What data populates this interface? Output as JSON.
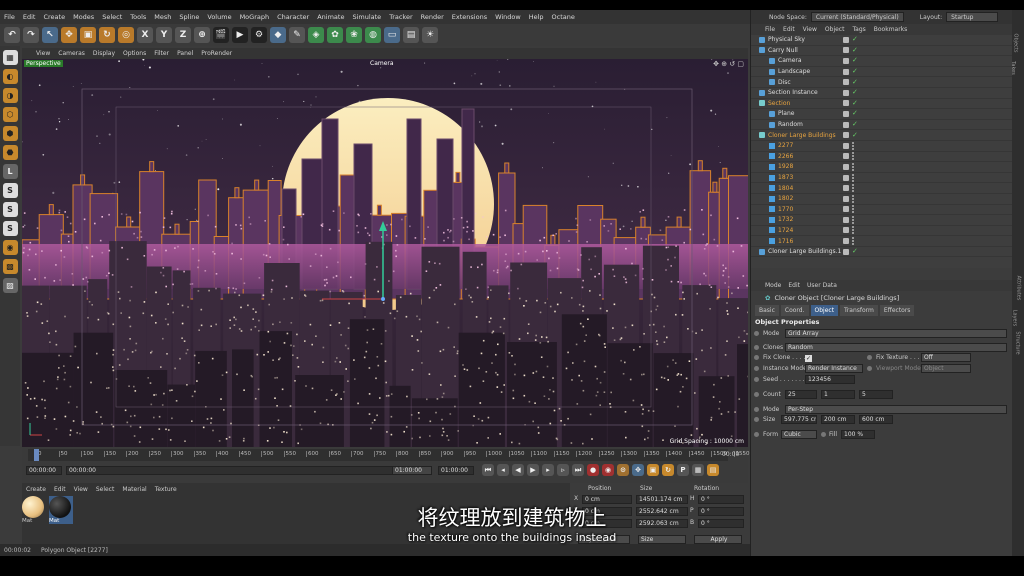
{
  "menubar": {
    "items": [
      "File",
      "Edit",
      "Create",
      "Modes",
      "Select",
      "Tools",
      "Mesh",
      "Spline",
      "Volume",
      "MoGraph",
      "Character",
      "Animate",
      "Simulate",
      "Tracker",
      "Render",
      "Extensions",
      "Window",
      "Help",
      "Octane"
    ]
  },
  "viewport": {
    "menu": [
      "View",
      "Cameras",
      "Display",
      "Options",
      "Filter",
      "Panel",
      "ProRender"
    ],
    "label_perspective": "Perspective",
    "label_camera": "Camera",
    "grid_spacing": "Grid Spacing : 10000 cm"
  },
  "timeline": {
    "ticks": [
      "0",
      "50",
      "100",
      "150",
      "200",
      "250",
      "300",
      "350",
      "400",
      "450",
      "500",
      "550",
      "600",
      "650",
      "700",
      "750",
      "800",
      "850",
      "900",
      "950",
      "1000",
      "1050",
      "1100",
      "1150",
      "1200",
      "1250",
      "1300",
      "1350",
      "1400",
      "1450",
      "1500",
      "1550"
    ],
    "frame_end_label": "00:00",
    "current_time": "00:00:00",
    "start_time": "00:00:00",
    "end_time": "01:00:00",
    "end_time2": "01:00:00"
  },
  "material_manager": {
    "menu": [
      "Create",
      "Edit",
      "View",
      "Select",
      "Material",
      "Texture"
    ],
    "materials": [
      {
        "name": "Mat"
      },
      {
        "name": "Mat"
      }
    ]
  },
  "coordinates": {
    "headers": [
      "Position",
      "Size",
      "Rotation"
    ],
    "rows": [
      {
        "axis": "X",
        "pos": "0 cm",
        "size": "14501.174 cm",
        "rot_axis": "H",
        "rot": "0 °"
      },
      {
        "axis": "Y",
        "pos": "0 cm",
        "size": "2552.642 cm",
        "rot_axis": "P",
        "rot": "0 °"
      },
      {
        "axis": "Z",
        "pos": "0 cm",
        "size": "2592.063 cm",
        "rot_axis": "B",
        "rot": "0 °"
      }
    ],
    "mode_select": "Object (Rel)",
    "size_select": "Size",
    "apply_label": "Apply"
  },
  "statusbar": {
    "time": "00:00:02",
    "message": "Polygon Object [2277]"
  },
  "rightpanel": {
    "nodespace_label": "Node Space:",
    "nodespace_value": "Current (Standard/Physical)",
    "layout_label": "Layout:",
    "layout_value": "Startup",
    "obj_menu": [
      "File",
      "Edit",
      "View",
      "Object",
      "Tags",
      "Bookmarks"
    ],
    "objects": [
      {
        "name": "Physical Sky",
        "indent": 0,
        "type": "normal"
      },
      {
        "name": "Carry Null",
        "indent": 0,
        "type": "normal"
      },
      {
        "name": "Camera",
        "indent": 1,
        "type": "normal"
      },
      {
        "name": "Landscape",
        "indent": 1,
        "type": "normal"
      },
      {
        "name": "Disc",
        "indent": 1,
        "type": "normal"
      },
      {
        "name": "Section Instance",
        "indent": 0,
        "type": "normal"
      },
      {
        "name": "Section",
        "indent": 0,
        "type": "hl"
      },
      {
        "name": "Plane",
        "indent": 1,
        "type": "normal"
      },
      {
        "name": "Random",
        "indent": 1,
        "type": "normal"
      },
      {
        "name": "Cloner Large Buildings",
        "indent": 0,
        "type": "hl"
      },
      {
        "name": "2277",
        "indent": 1,
        "type": "sub"
      },
      {
        "name": "2266",
        "indent": 1,
        "type": "sub"
      },
      {
        "name": "1928",
        "indent": 1,
        "type": "sub"
      },
      {
        "name": "1873",
        "indent": 1,
        "type": "sub"
      },
      {
        "name": "1804",
        "indent": 1,
        "type": "sub"
      },
      {
        "name": "1802",
        "indent": 1,
        "type": "sub"
      },
      {
        "name": "1770",
        "indent": 1,
        "type": "sub"
      },
      {
        "name": "1732",
        "indent": 1,
        "type": "sub"
      },
      {
        "name": "1724",
        "indent": 1,
        "type": "sub"
      },
      {
        "name": "1716",
        "indent": 1,
        "type": "sub"
      },
      {
        "name": "Cloner Large Buildings.1",
        "indent": 0,
        "type": "normal"
      }
    ],
    "attr_menu": [
      "Mode",
      "Edit",
      "User Data"
    ],
    "attr_title": "Cloner Object [Cloner Large Buildings]",
    "attr_tabs": [
      "Basic",
      "Coord.",
      "Object",
      "Transform",
      "Effectors"
    ],
    "attr_active_tab": "Object",
    "section_title": "Object Properties",
    "props": {
      "mode_label": "Mode",
      "mode_value": "Grid Array",
      "clones_label": "Clones",
      "clones_value": "Random",
      "fix_clone_label": "Fix Clone . . . .",
      "fix_texture_label": "Fix Texture . . .",
      "fix_texture_value": "Off",
      "instance_mode_label": "Instance Mode",
      "instance_mode_value": "Render Instance",
      "viewport_mode_label": "Viewport Mode",
      "viewport_mode_value": "Object",
      "seed_label": "Seed . . . . . . .",
      "seed_value": "123456",
      "count_label": "Count",
      "count_values": [
        "25",
        "1",
        "5"
      ],
      "mode2_label": "Mode",
      "mode2_value": "Per-Step",
      "size_label": "Size",
      "size_values": [
        "597.775 cm",
        "200 cm",
        "600 cm"
      ],
      "form_label": "Form",
      "form_value": "Cubic",
      "fill_label": "Fill",
      "fill_value": "100 %"
    },
    "side_tabs": [
      "Objects",
      "Takes",
      "Content Browser",
      "Attributes",
      "Layers",
      "Structure"
    ]
  },
  "subtitle": {
    "cn": "将纹理放到建筑物上",
    "en": "the texture onto the buildings instead"
  },
  "colors": {
    "accent_orange": "#e8a440",
    "sky_top": "#2a1e33",
    "sun": "#f8e6a8",
    "buildings_pink": "#a14c92",
    "outline_orange": "#d9822b"
  }
}
